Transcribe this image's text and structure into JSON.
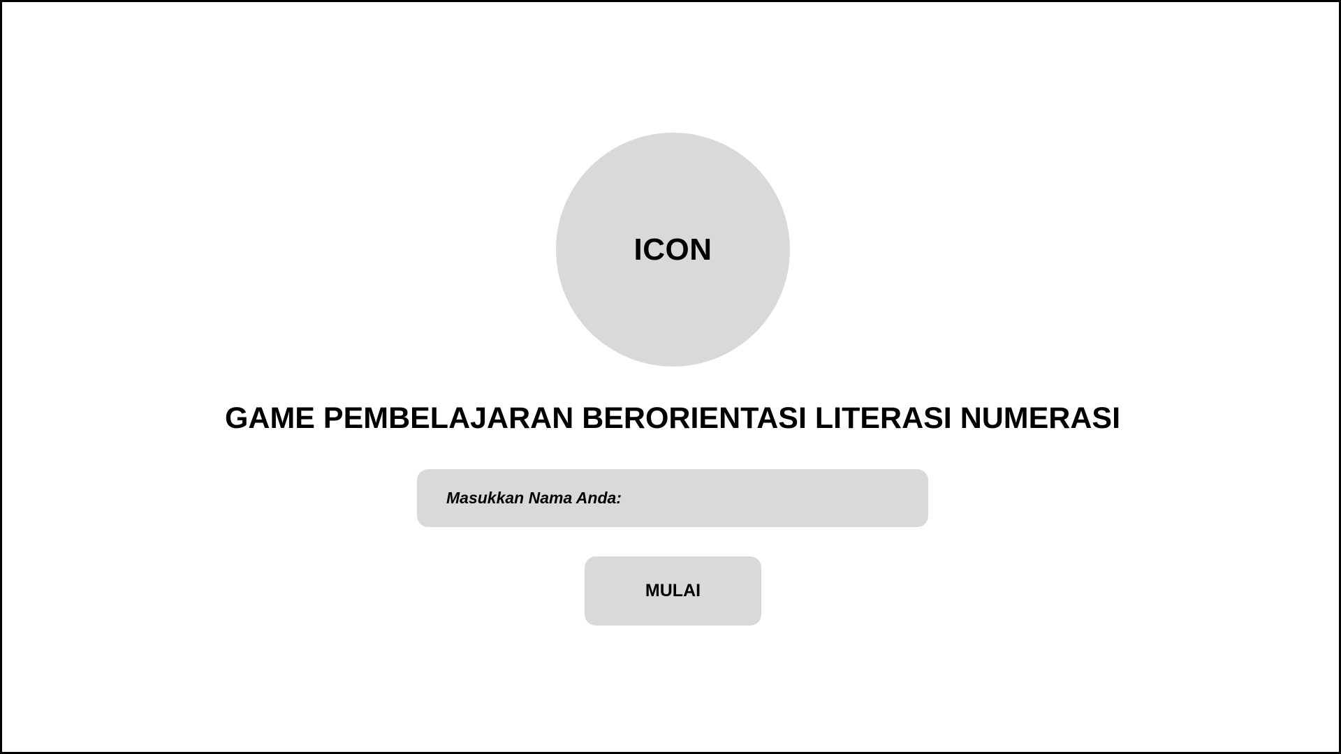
{
  "logo": {
    "label": "ICON"
  },
  "title": "GAME PEMBELAJARAN BERORIENTASI LITERASI NUMERASI",
  "name_input": {
    "placeholder": "Masukkan Nama Anda:",
    "value": ""
  },
  "start_button": {
    "label": "MULAI"
  },
  "colors": {
    "background": "#ffffff",
    "border": "#000000",
    "surface": "#d9d9d9",
    "text": "#000000"
  }
}
